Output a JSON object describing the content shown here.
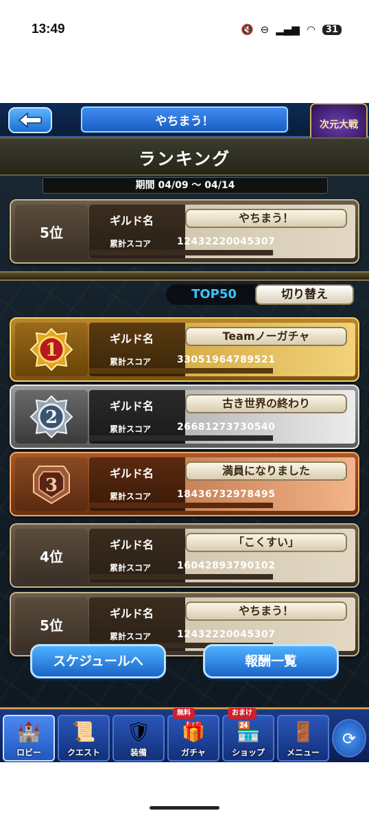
{
  "status": {
    "time": "13:49",
    "battery": "31"
  },
  "header": {
    "title": "やちまう！",
    "event_badge": "次元大戦"
  },
  "page": {
    "heading": "ランキング",
    "period": "期間 04/09 ～ 04/14"
  },
  "labels": {
    "guild_name": "ギルド名",
    "total_score": "累計スコア"
  },
  "my_guild": {
    "rank": "5位",
    "name": "やちまう！",
    "score": "12432220045307"
  },
  "filter": {
    "top_label": "TOP50",
    "switch_label": "切り替え"
  },
  "rankings": [
    {
      "rank": "1",
      "name": "Teamノーガチャ",
      "score": "33051964789521",
      "tier": "gold"
    },
    {
      "rank": "2",
      "name": "古き世界の終わり",
      "score": "26681273730540",
      "tier": "silver"
    },
    {
      "rank": "3",
      "name": "満員になりました",
      "score": "18436732978495",
      "tier": "bronze"
    },
    {
      "rank": "4位",
      "name": "「こくすい」",
      "score": "16042893790102",
      "tier": "normal"
    },
    {
      "rank": "5位",
      "name": "やちまう！",
      "score": "12432220045307",
      "tier": "normal"
    }
  ],
  "buttons": {
    "schedule": "スケジュールへ",
    "rewards": "報酬一覧"
  },
  "nav": [
    {
      "label": "ロビー",
      "icon": "castle-icon"
    },
    {
      "label": "クエスト",
      "icon": "scroll-icon"
    },
    {
      "label": "装備",
      "icon": "armor-icon"
    },
    {
      "label": "ガチャ",
      "icon": "chest-icon",
      "tag": "無料"
    },
    {
      "label": "ショップ",
      "icon": "shop-icon",
      "tag": "おまけ"
    },
    {
      "label": "メニュー",
      "icon": "menu-icon"
    },
    {
      "label": "",
      "icon": "refresh-icon"
    }
  ],
  "colors": {
    "gold": "#f4d070",
    "silver": "#e8e8e8",
    "bronze": "#f0a868",
    "accent_blue": "#39c7ff"
  }
}
